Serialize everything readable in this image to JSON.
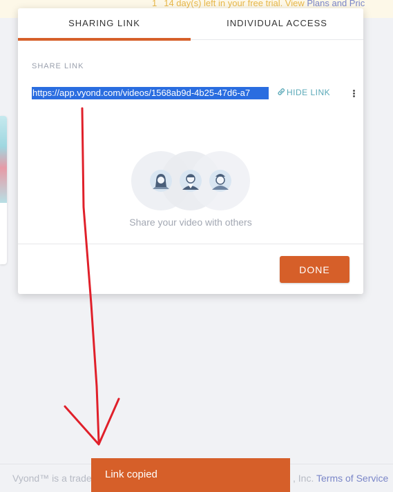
{
  "banner": {
    "number": "1",
    "text": "14 day(s) left in your free trial. View",
    "link": "Plans and Pric"
  },
  "modal": {
    "tabs": [
      {
        "label": "SHARING LINK",
        "active": true
      },
      {
        "label": "INDIVIDUAL ACCESS",
        "active": false
      }
    ],
    "share_link_label": "SHARE LINK",
    "link_url": "https://app.vyond.com/videos/1568ab9d-4b25-47d6-a7",
    "hide_link_label": "HIDE LINK",
    "share_text": "Share your video with others",
    "done_label": "DONE"
  },
  "footer": {
    "left_text": "Vyond™ is a trade",
    "right_text": ", Inc.",
    "terms_link": "Terms of Service"
  },
  "toast": {
    "message": "Link copied"
  },
  "colors": {
    "accent": "#d65f29",
    "link_teal": "#5aa9b8",
    "annotation_red": "#e0202a",
    "selection_blue": "#2a6de0"
  },
  "icons": [
    "link-icon",
    "more-options-icon",
    "user-female-icon",
    "user-male-icon",
    "user-cap-icon"
  ]
}
